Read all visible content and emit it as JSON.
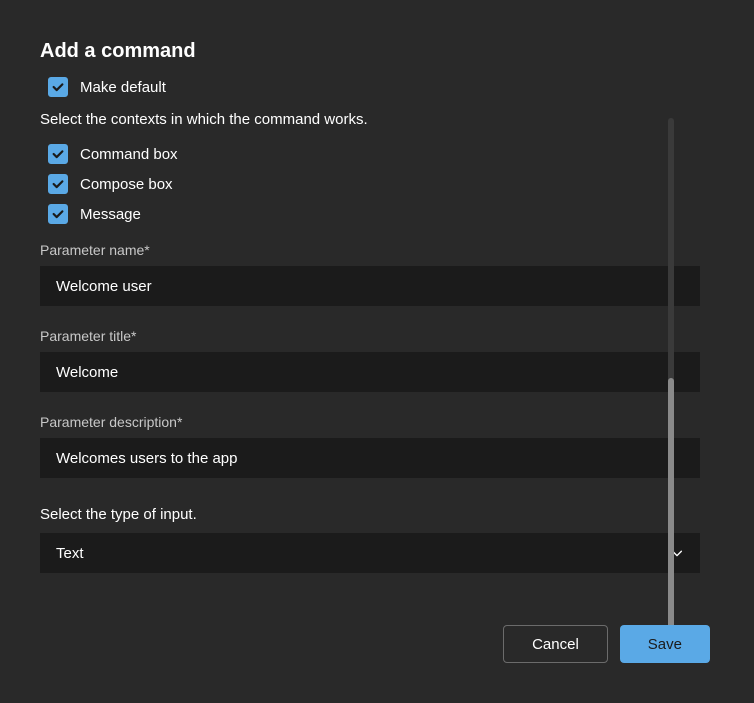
{
  "heading": "Add a command",
  "makeDefault": {
    "label": "Make default",
    "checked": true
  },
  "contextsDescription": "Select the contexts in which the command works.",
  "contexts": [
    {
      "label": "Command box",
      "checked": true
    },
    {
      "label": "Compose box",
      "checked": true
    },
    {
      "label": "Message",
      "checked": true
    }
  ],
  "parameterName": {
    "label": "Parameter name*",
    "value": "Welcome user"
  },
  "parameterTitle": {
    "label": "Parameter title*",
    "value": "Welcome"
  },
  "parameterDescription": {
    "label": "Parameter description*",
    "value": "Welcomes users to the app"
  },
  "inputType": {
    "label": "Select the type of input.",
    "value": "Text"
  },
  "buttons": {
    "cancel": "Cancel",
    "save": "Save"
  }
}
